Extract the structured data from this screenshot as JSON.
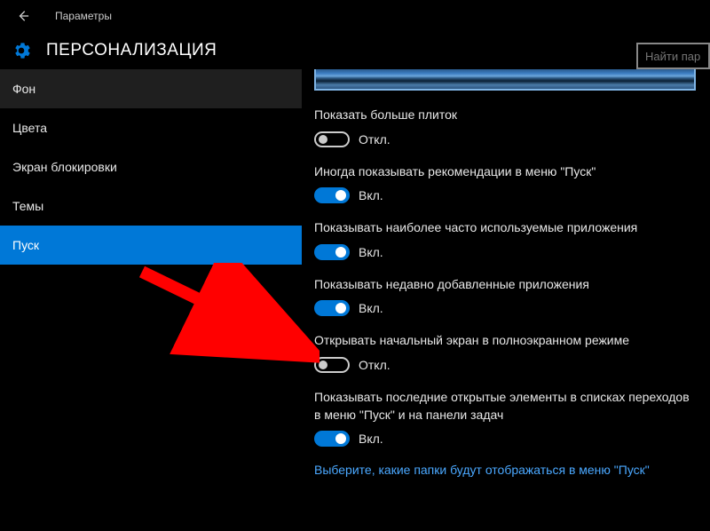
{
  "header": {
    "breadcrumb": "Параметры",
    "title": "ПЕРСОНАЛИЗАЦИЯ",
    "search_placeholder": "Найти пар"
  },
  "sidebar": {
    "items": [
      {
        "label": "Фон"
      },
      {
        "label": "Цвета"
      },
      {
        "label": "Экран блокировки"
      },
      {
        "label": "Темы"
      },
      {
        "label": "Пуск"
      }
    ]
  },
  "main": {
    "settings": [
      {
        "label": "Показать больше плиток",
        "state": "Откл.",
        "on": false
      },
      {
        "label": "Иногда показывать рекомендации в меню \"Пуск\"",
        "state": "Вкл.",
        "on": true
      },
      {
        "label": "Показывать наиболее часто используемые приложения",
        "state": "Вкл.",
        "on": true
      },
      {
        "label": "Показывать недавно добавленные приложения",
        "state": "Вкл.",
        "on": true
      },
      {
        "label": "Открывать начальный экран в полноэкранном режиме",
        "state": "Откл.",
        "on": false
      },
      {
        "label": "Показывать последние открытые элементы в списках переходов в меню \"Пуск\" и на панели задач",
        "state": "Вкл.",
        "on": true
      }
    ],
    "link": "Выберите, какие папки будут отображаться в меню \"Пуск\""
  },
  "colors": {
    "accent": "#0078d7",
    "link": "#4aa8ff",
    "arrow": "#ff0000"
  }
}
